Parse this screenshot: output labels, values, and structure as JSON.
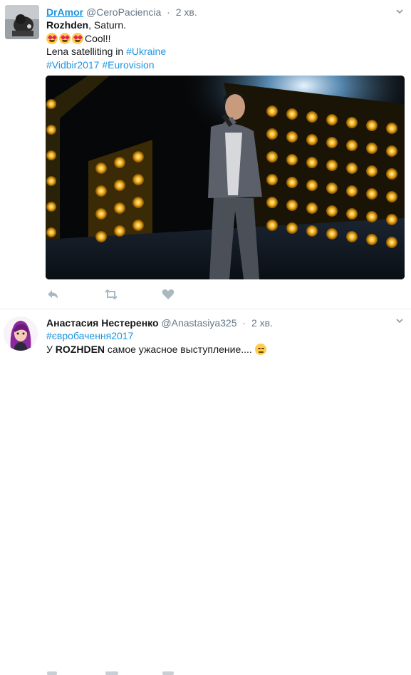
{
  "tweets": [
    {
      "author_name": "DrAmor",
      "handle": "@CeroPaciencia",
      "separator": "·",
      "time": "2 хв.",
      "line1_bold": "Rozhden",
      "line1_rest": ", Saturn.",
      "line2_text": "Cool!!",
      "line3_text": "Lena satelliting in ",
      "line3_tag": "#Ukraine",
      "line4_tag1": "#Vidbir2017",
      "line4_tag2": "#Eurovision",
      "has_video": true
    },
    {
      "author_name": "Анастасия Нестеренко",
      "handle": "@Anastasiya325",
      "separator": "·",
      "time": "2 хв.",
      "line1_tag": "#євробачення2017",
      "line2_prefix": "У ",
      "line2_bold": "ROZHDEN",
      "line2_rest": " самое ужасное выступление...."
    }
  ],
  "icons": {
    "reply": "reply-icon",
    "retweet": "retweet-icon",
    "like": "heart-icon",
    "caret": "chevron-down-icon",
    "emoji_love": "heart-eyes-emoji",
    "emoji_neutral": "expressionless-emoji"
  },
  "colors": {
    "link": "#1b95e0",
    "text": "#14171a",
    "muted": "#657786",
    "divider": "#e6ecf0",
    "stage_light": "#f2b01e"
  }
}
